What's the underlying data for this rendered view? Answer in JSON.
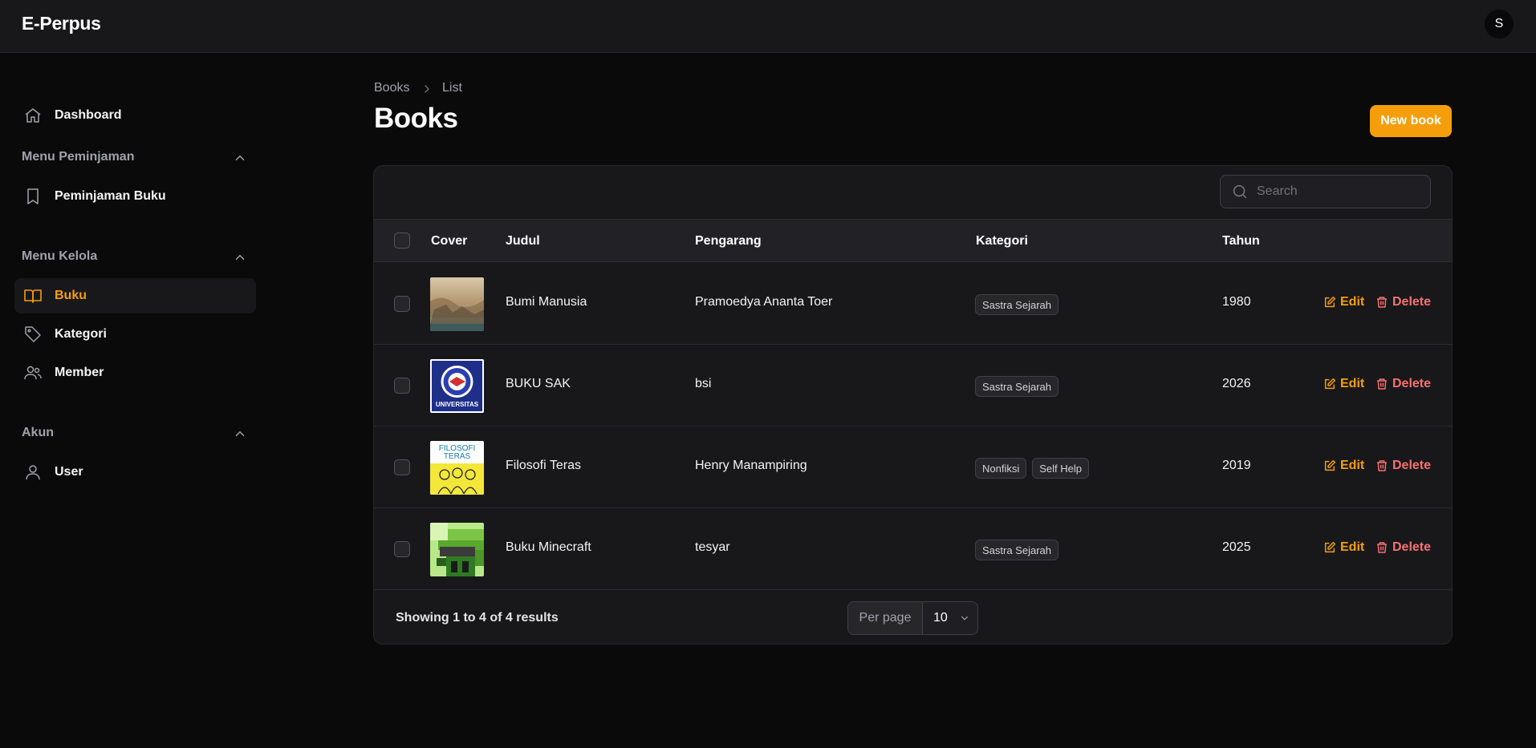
{
  "app": {
    "brand": "E-Perpus",
    "user_initial": "S"
  },
  "sidebar": {
    "dashboard": "Dashboard",
    "groups": [
      {
        "label": "Menu Peminjaman",
        "items": [
          "Peminjaman Buku"
        ]
      },
      {
        "label": "Menu Kelola",
        "items": [
          "Buku",
          "Kategori",
          "Member"
        ]
      },
      {
        "label": "Akun",
        "items": [
          "User"
        ]
      }
    ],
    "active_item": "Buku"
  },
  "breadcrumb": [
    "Books",
    "List"
  ],
  "page": {
    "title": "Books",
    "new_button": "New book"
  },
  "search": {
    "placeholder": "Search"
  },
  "table": {
    "headers": [
      "Cover",
      "Judul",
      "Pengarang",
      "Kategori",
      "Tahun"
    ],
    "rows": [
      {
        "judul": "Bumi Manusia",
        "pengarang": "Pramoedya Ananta Toer",
        "kategori": [
          "Sastra Sejarah"
        ],
        "tahun": "1980"
      },
      {
        "judul": "BUKU SAK",
        "pengarang": "bsi",
        "kategori": [
          "Sastra Sejarah"
        ],
        "tahun": "2026"
      },
      {
        "judul": "Filosofi Teras",
        "pengarang": "Henry Manampiring",
        "kategori": [
          "Nonfiksi",
          "Self Help"
        ],
        "tahun": "2019"
      },
      {
        "judul": "Buku Minecraft",
        "pengarang": "tesyar",
        "kategori": [
          "Sastra Sejarah"
        ],
        "tahun": "2025"
      }
    ],
    "actions": {
      "edit": "Edit",
      "delete": "Delete"
    }
  },
  "covers": {
    "row2_text": "UNIVERSITAS",
    "row3_text": [
      "FILOSOFI",
      "TERAS"
    ]
  },
  "footer": {
    "showing_prefix": "Showing ",
    "showing_from": "1",
    "showing_to_word": " to ",
    "showing_to": "4",
    "showing_of_word": " of ",
    "showing_total": "4",
    "showing_suffix": " results",
    "per_page_label": "Per page",
    "per_page_value": "10"
  },
  "colors": {
    "accent": "#f59e0b",
    "danger": "#f87171",
    "background": "#0a0a0b",
    "surface": "#18181b"
  }
}
